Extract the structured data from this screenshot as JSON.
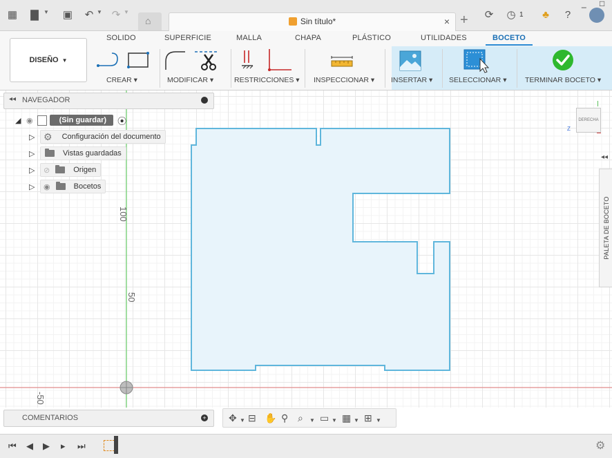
{
  "app": {
    "document_title": "Sin título*",
    "notification_count": "1"
  },
  "ribbon": {
    "tabs": [
      {
        "label": "SOLIDO"
      },
      {
        "label": "SUPERFICIE"
      },
      {
        "label": "MALLA"
      },
      {
        "label": "CHAPA"
      },
      {
        "label": "PLÁSTICO"
      },
      {
        "label": "UTILIDADES"
      },
      {
        "label": "BOCETO",
        "active": true
      }
    ],
    "workspace_label": "DISEÑO",
    "groups": [
      {
        "label": "CREAR"
      },
      {
        "label": "MODIFICAR"
      },
      {
        "label": "RESTRICCIONES"
      },
      {
        "label": "INSPECCIONAR"
      },
      {
        "label": "INSERTAR"
      },
      {
        "label": "SELECCIONAR"
      },
      {
        "label": "TERMINAR BOCETO"
      }
    ],
    "accent_color": "#1a6fb5",
    "finish_color": "#2eb82e"
  },
  "navigator": {
    "title": "NAVEGADOR",
    "root": "(Sin guardar)",
    "items": [
      {
        "label": "Configuración del documento",
        "icon": "gear-icon"
      },
      {
        "label": "Vistas guardadas",
        "icon": "folder-icon"
      },
      {
        "label": "Origen",
        "icon": "folder-icon",
        "hidden": true
      },
      {
        "label": "Bocetos",
        "icon": "folder-icon"
      }
    ]
  },
  "canvas": {
    "axis_labels": [
      "100",
      "50",
      "-50"
    ],
    "viewcube_label": "DERECHA",
    "sketch_fill": "#e8f4fb",
    "sketch_stroke": "#5fb6dc"
  },
  "palette": {
    "label": "PALETA DE BOCETO"
  },
  "comments": {
    "label": "COMENTARIOS"
  }
}
